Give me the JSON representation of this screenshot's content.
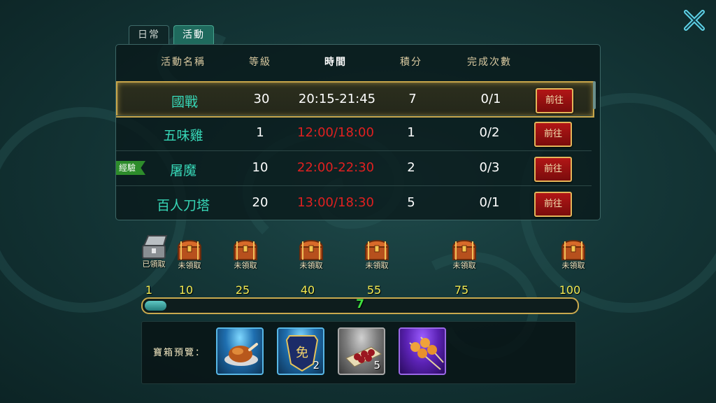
{
  "tabs": [
    {
      "label": "日常",
      "active": false
    },
    {
      "label": "活動",
      "active": true
    }
  ],
  "table": {
    "headers": {
      "name": "活動名稱",
      "level": "等級",
      "time": "時間",
      "points": "積分",
      "completions": "完成次數"
    },
    "rows": [
      {
        "name": "國戰",
        "level": "30",
        "time": "20:15-21:45",
        "time_color": "white",
        "points": "7",
        "completions": "0/1",
        "button": "前往",
        "badge": ""
      },
      {
        "name": "五味雞",
        "level": "1",
        "time": "12:00/18:00",
        "time_color": "red",
        "points": "1",
        "completions": "0/2",
        "button": "前往",
        "badge": ""
      },
      {
        "name": "屠魔",
        "level": "10",
        "time": "22:00-22:30",
        "time_color": "red",
        "points": "2",
        "completions": "0/3",
        "button": "前往",
        "badge": "經驗"
      },
      {
        "name": "百人刀塔",
        "level": "20",
        "time": "13:00/18:30",
        "time_color": "red",
        "points": "5",
        "completions": "0/1",
        "button": "前往",
        "badge": ""
      }
    ]
  },
  "chests": [
    {
      "label": "已領取",
      "state": "claimed",
      "milestone": "1"
    },
    {
      "label": "未領取",
      "state": "unclaimed",
      "milestone": "10"
    },
    {
      "label": "未領取",
      "state": "unclaimed",
      "milestone": "25"
    },
    {
      "label": "未領取",
      "state": "unclaimed",
      "milestone": "40"
    },
    {
      "label": "未領取",
      "state": "unclaimed",
      "milestone": "55"
    },
    {
      "label": "未領取",
      "state": "unclaimed",
      "milestone": "75"
    },
    {
      "label": "未領取",
      "state": "unclaimed",
      "milestone": "100"
    }
  ],
  "progress": {
    "value": "7",
    "max": 100,
    "fraction": 0.05
  },
  "preview": {
    "label": "寶箱預覽：",
    "items": [
      {
        "icon": "roast-chicken-icon",
        "rarity": "blue",
        "count": ""
      },
      {
        "icon": "exemption-token-icon",
        "rarity": "blue",
        "count": "2",
        "text": "免"
      },
      {
        "icon": "meat-platter-icon",
        "rarity": "gray",
        "count": "5"
      },
      {
        "icon": "skewer-icon",
        "rarity": "purple",
        "count": ""
      }
    ]
  },
  "colors": {
    "name_cyan": "#37d6b6",
    "time_red": "#e02020",
    "milestone_yellow": "#f2ea52",
    "progress_green": "#3fe03f",
    "button_red": "#b21616",
    "gold_border": "#c7a54a"
  },
  "icons": {
    "close": "close-x-icon"
  }
}
